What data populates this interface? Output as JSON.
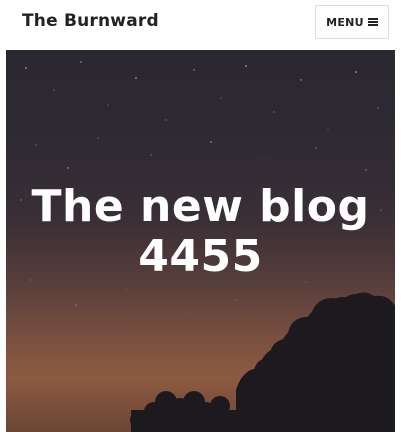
{
  "header": {
    "site_title": "The Burnward",
    "menu_label": "MENU"
  },
  "hero": {
    "title_line1": "The new blog",
    "title_line2": "4455"
  },
  "icons": {
    "menu": "hamburger-icon"
  }
}
